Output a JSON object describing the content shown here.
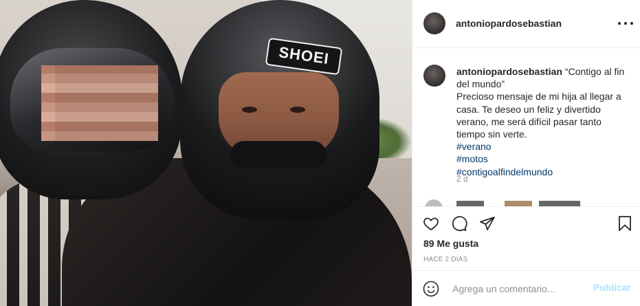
{
  "post": {
    "username": "antoniopardosebastian",
    "caption_quote": "“Contigo al fin del mundo”",
    "caption_body": "Precioso mensaje de mi hija al llegar a casa. Te deseo un feliz y divertido verano, me será difícil pasar tanto tiempo sin verte.",
    "hashtags": [
      "#verano",
      "#motos",
      "#contigoalfindelmundo"
    ],
    "time_short": "2 d",
    "likes": "89 Me gusta",
    "time_long": "HACE 2 DÍAS"
  },
  "photo": {
    "helmet_brand": "SHOEI"
  },
  "comment": {
    "placeholder": "Agrega un comentario...",
    "publish_label": "Publicar"
  },
  "icons": [
    "more-icon",
    "heart-icon",
    "comment-icon",
    "share-icon",
    "bookmark-icon",
    "emoji-icon"
  ]
}
